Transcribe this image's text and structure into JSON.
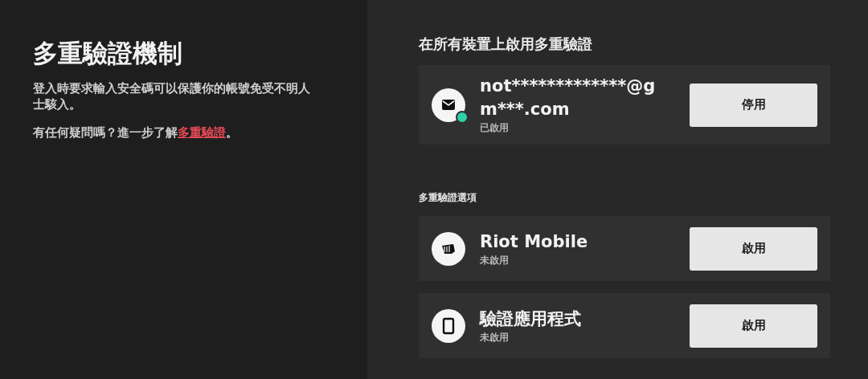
{
  "intro": {
    "title": "多重驗證機制",
    "description": "登入時要求輸入安全碼可以保護你的帳號免受不明人士駭入。",
    "help_text": "有任何疑問嗎？進一步了解",
    "help_link": "多重驗證",
    "help_suffix": "。"
  },
  "active_section": {
    "heading": "在所有裝置上啟用多重驗證",
    "methods": [
      {
        "kind": "mail",
        "name": "not*************@gm***.com",
        "status": "已啟用",
        "enabled": true,
        "button": "停用"
      }
    ]
  },
  "options_section": {
    "heading": "多重驗證選項",
    "methods": [
      {
        "kind": "fist",
        "name": "Riot Mobile",
        "status": "未啟用",
        "enabled": false,
        "button": "啟用"
      },
      {
        "kind": "phone",
        "name": "驗證應用程式",
        "status": "未啟用",
        "enabled": false,
        "button": "啟用"
      }
    ]
  }
}
